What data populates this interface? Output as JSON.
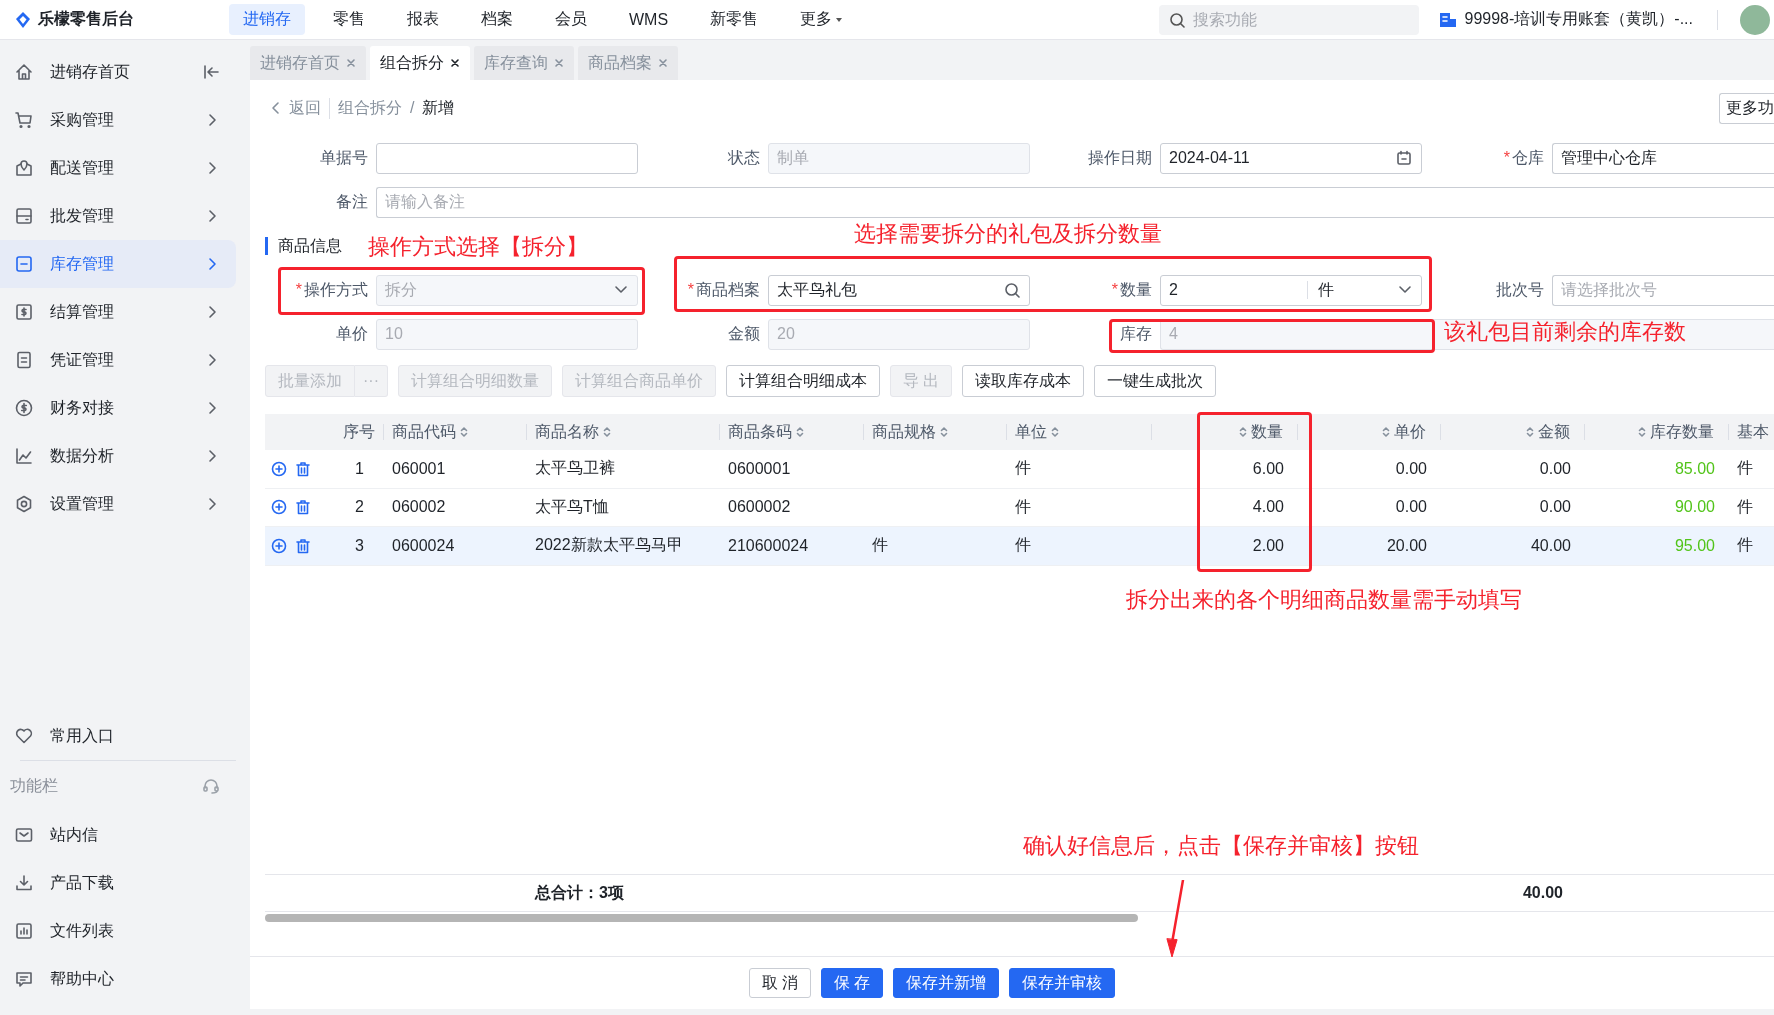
{
  "app": {
    "title": "乐檬零售后台"
  },
  "top_nav": [
    {
      "label": "进销存",
      "selected": true,
      "dropdown": false
    },
    {
      "label": "零售",
      "selected": false,
      "dropdown": false
    },
    {
      "label": "报表",
      "selected": false,
      "dropdown": false
    },
    {
      "label": "档案",
      "selected": false,
      "dropdown": false
    },
    {
      "label": "会员",
      "selected": false,
      "dropdown": false
    },
    {
      "label": "WMS",
      "selected": false,
      "dropdown": false
    },
    {
      "label": "新零售",
      "selected": false,
      "dropdown": false
    },
    {
      "label": "更多",
      "selected": false,
      "dropdown": true
    }
  ],
  "search": {
    "placeholder": "搜索功能"
  },
  "account": {
    "name": "99998-培训专用账套（黄凯）-..."
  },
  "sidebar": {
    "items": [
      {
        "label": "进销存首页",
        "selected": false,
        "kind": "home"
      },
      {
        "label": "采购管理",
        "selected": false,
        "kind": "cart"
      },
      {
        "label": "配送管理",
        "selected": false,
        "kind": "map"
      },
      {
        "label": "批发管理",
        "selected": false,
        "kind": "card"
      },
      {
        "label": "库存管理",
        "selected": true,
        "kind": "box"
      },
      {
        "label": "结算管理",
        "selected": false,
        "kind": "dollar-box"
      },
      {
        "label": "凭证管理",
        "selected": false,
        "kind": "doc"
      },
      {
        "label": "财务对接",
        "selected": false,
        "kind": "dollar-circle"
      },
      {
        "label": "数据分析",
        "selected": false,
        "kind": "chart"
      },
      {
        "label": "设置管理",
        "selected": false,
        "kind": "hexagon"
      }
    ],
    "favorites": {
      "label": "常用入口"
    },
    "tools_title": "功能栏",
    "tools": [
      {
        "label": "站内信",
        "kind": "mail"
      },
      {
        "label": "产品下载",
        "kind": "download"
      },
      {
        "label": "文件列表",
        "kind": "bars"
      },
      {
        "label": "帮助中心",
        "kind": "chat"
      }
    ]
  },
  "page_tabs": [
    {
      "label": "进销存首页",
      "selected": false
    },
    {
      "label": "组合拆分",
      "selected": true
    },
    {
      "label": "库存查询",
      "selected": false
    },
    {
      "label": "商品档案",
      "selected": false
    }
  ],
  "breadcrumb": {
    "back": "返回",
    "path": [
      "组合拆分",
      "新增"
    ],
    "separator": "/",
    "more": "更多功"
  },
  "required_mark": "*",
  "header_fields": [
    {
      "label": "单据号",
      "required": false,
      "kind": "text",
      "disabled": false
    },
    {
      "label": "状态",
      "required": false,
      "kind": "text",
      "value": "制单",
      "disabled": true
    },
    {
      "label": "操作日期",
      "required": false,
      "kind": "date",
      "value": "2024-04-11",
      "disabled": false
    },
    {
      "label": "仓库",
      "required": true,
      "kind": "text",
      "value": "管理中心仓库",
      "disabled": false
    },
    {
      "label": "备注",
      "required": false,
      "kind": "text",
      "placeholder": "请输入备注",
      "disabled": false
    }
  ],
  "section_title": "商品信息",
  "item_fields": [
    {
      "label": "操作方式",
      "required": true,
      "kind": "select",
      "value": "拆分",
      "disabled": true
    },
    {
      "label": "商品档案",
      "required": true,
      "kind": "search",
      "value": "太平鸟礼包",
      "disabled": false
    },
    {
      "label": "数量",
      "required": true,
      "kind": "quantity",
      "value": "2",
      "unit": "件",
      "disabled": false
    },
    {
      "label": "批次号",
      "required": false,
      "kind": "text",
      "placeholder": "请选择批次号",
      "disabled": false
    },
    {
      "label": "单价",
      "required": false,
      "kind": "text",
      "value": "10",
      "disabled": true
    },
    {
      "label": "金额",
      "required": false,
      "kind": "text",
      "value": "20",
      "disabled": true
    },
    {
      "label": "库存",
      "required": false,
      "kind": "text",
      "value": "4",
      "disabled": true
    }
  ],
  "actions": [
    {
      "label": "批量添加",
      "kind": "split",
      "more": "···",
      "disabled": true
    },
    {
      "label": "计算组合明细数量",
      "kind": "button",
      "disabled": true
    },
    {
      "label": "计算组合商品单价",
      "kind": "button",
      "disabled": true
    },
    {
      "label": "计算组合明细成本",
      "kind": "button",
      "disabled": false
    },
    {
      "label": "导 出",
      "kind": "button",
      "disabled": true
    },
    {
      "label": "读取库存成本",
      "kind": "button",
      "disabled": false
    },
    {
      "label": "一键生成批次",
      "kind": "button",
      "disabled": false
    }
  ],
  "table": {
    "columns": [
      {
        "label": "序号",
        "sortable": false
      },
      {
        "label": "商品代码",
        "sortable": true
      },
      {
        "label": "商品名称",
        "sortable": true
      },
      {
        "label": "商品条码",
        "sortable": true
      },
      {
        "label": "商品规格",
        "sortable": true
      },
      {
        "label": "单位",
        "sortable": true
      },
      {
        "label": "数量",
        "sortable": true
      },
      {
        "label": "单价",
        "sortable": true
      },
      {
        "label": "金额",
        "sortable": true
      },
      {
        "label": "库存数量",
        "sortable": true
      },
      {
        "label": "基本",
        "sortable": false
      }
    ],
    "rows": [
      {
        "selected": false,
        "cells": [
          "1",
          "060001",
          "太平鸟卫裤",
          "0600001",
          "",
          "件",
          "6.00",
          "0.00",
          "0.00",
          "85.00",
          "件"
        ]
      },
      {
        "selected": false,
        "cells": [
          "2",
          "060002",
          "太平鸟T恤",
          "0600002",
          "",
          "件",
          "4.00",
          "0.00",
          "0.00",
          "90.00",
          "件"
        ]
      },
      {
        "selected": true,
        "cells": [
          "3",
          "0600024",
          "2022新款太平鸟马甲",
          "210600024",
          "件",
          "件",
          "2.00",
          "20.00",
          "40.00",
          "95.00",
          "件"
        ]
      }
    ],
    "total": {
      "label": "总合计：3项",
      "amount": "40.00"
    }
  },
  "footer_buttons": [
    {
      "label": "取 消",
      "kind": "default"
    },
    {
      "label": "保 存",
      "kind": "primary"
    },
    {
      "label": "保存并新增",
      "kind": "primary"
    },
    {
      "label": "保存并审核",
      "kind": "primary"
    }
  ],
  "annotations": [
    {
      "kind": "boxed-note",
      "text": "操作方式选择【拆分】"
    },
    {
      "kind": "boxed-note",
      "text": "选择需要拆分的礼包及拆分数量"
    },
    {
      "kind": "boxed-note",
      "text": "该礼包目前剩余的库存数"
    },
    {
      "kind": "boxed-note",
      "text": "拆分出来的各个明细商品数量需手动填写"
    },
    {
      "kind": "arrow-note",
      "text": "确认好信息后，点击【保存并审核】按钮"
    }
  ]
}
